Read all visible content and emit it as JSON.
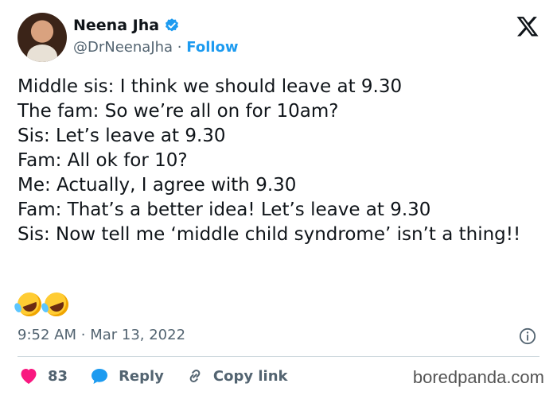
{
  "author": {
    "name": "Neena Jha",
    "handle": "@DrNeenaJha",
    "separator": "·",
    "follow_label": "Follow",
    "verified_color": "#1d9bf0"
  },
  "tweet": {
    "lines": [
      "Middle sis: I think we should leave at 9.30",
      "The fam: So we’re all on for 10am?",
      "Sis: Let’s leave at 9.30",
      "Fam: All ok for 10?",
      "Me: Actually, I agree with 9.30",
      "Fam: That’s a better idea! Let’s leave at 9.30",
      "Sis: Now tell me ‘middle child syndrome’ isn’t a thing!!"
    ],
    "emojis": [
      "rolling-on-floor-laughing",
      "rolling-on-floor-laughing"
    ],
    "time": "9:52 AM",
    "date_separator": "·",
    "date": "Mar 13, 2022"
  },
  "actions": {
    "like_count": "83",
    "reply_label": "Reply",
    "copy_link_label": "Copy link"
  },
  "watermark": "boredpanda.com",
  "colors": {
    "like": "#f91880",
    "reply": "#1d9bf0",
    "follow": "#1d9bf0",
    "muted": "#536471"
  }
}
